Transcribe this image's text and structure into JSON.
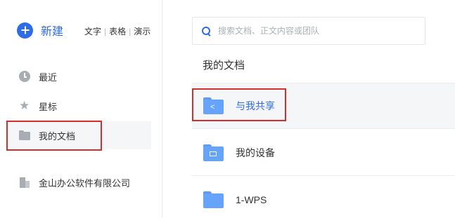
{
  "sidebar": {
    "new_label": "新建",
    "quick": [
      "文字",
      "表格",
      "演示"
    ],
    "items": [
      {
        "label": "最近",
        "icon": "clock-icon"
      },
      {
        "label": "星标",
        "icon": "star-icon"
      },
      {
        "label": "我的文档",
        "icon": "folder-icon"
      },
      {
        "label": "金山办公软件有限公司",
        "icon": "building-icon"
      }
    ]
  },
  "search": {
    "placeholder": "搜索文档、正文内容或团队"
  },
  "main": {
    "section_title": "我的文档",
    "rows": [
      {
        "label": "与我共享",
        "icon": "shared-folder-icon"
      },
      {
        "label": "我的设备",
        "icon": "device-folder-icon"
      },
      {
        "label": "1-WPS",
        "icon": "folder-icon"
      }
    ]
  },
  "colors": {
    "accent": "#2e6ce6",
    "folder": "#66a3fa",
    "highlight": "#d32f2f"
  }
}
